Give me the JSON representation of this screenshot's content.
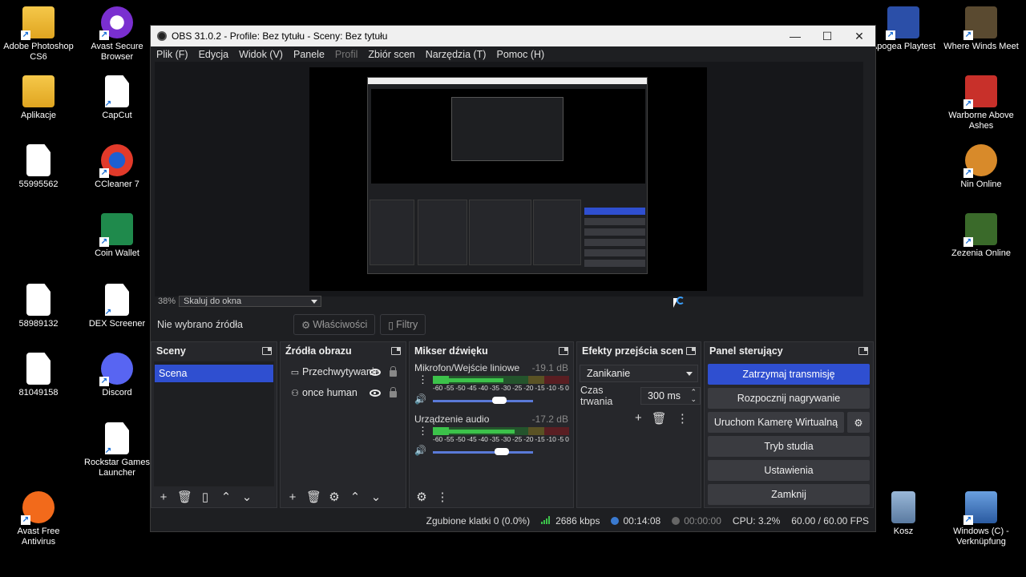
{
  "desktop": {
    "left_icons": [
      {
        "label": "Adobe Photoshop CS6",
        "kind": "folder"
      },
      {
        "label": "Avast Secure Browser",
        "kind": "app"
      },
      {
        "label": "Aplikacje",
        "kind": "folder"
      },
      {
        "label": "CapCut",
        "kind": "doc"
      },
      {
        "label": "55995562",
        "kind": "doc"
      },
      {
        "label": "CCleaner 7",
        "kind": "app"
      },
      {
        "label": "Coin Wallet",
        "kind": "app"
      },
      {
        "label": "58989132",
        "kind": "doc"
      },
      {
        "label": "DEX Screener",
        "kind": "doc"
      },
      {
        "label": "81049158",
        "kind": "doc"
      },
      {
        "label": "Discord",
        "kind": "app"
      },
      {
        "label": "Rockstar Games Launcher",
        "kind": "doc"
      },
      {
        "label": "Avast Free Antivirus",
        "kind": "app"
      }
    ],
    "right_icons": [
      {
        "label": "Apogea Playtest"
      },
      {
        "label": "Where Winds Meet"
      },
      {
        "label": "Warborne Above Ashes"
      },
      {
        "label": "Nin Online"
      },
      {
        "label": "Zezenia Online"
      },
      {
        "label": "Kosz"
      },
      {
        "label": "Windows (C) - Verknüpfung"
      }
    ]
  },
  "window": {
    "title": "OBS 31.0.2 - Profile: Bez tytułu - Sceny: Bez tytułu",
    "controls": {
      "minimize": "—",
      "maximize": "☐",
      "close": "✕"
    }
  },
  "menu": [
    {
      "label": "Plik (F)",
      "enabled": true
    },
    {
      "label": "Edycja",
      "enabled": true
    },
    {
      "label": "Widok (V)",
      "enabled": true
    },
    {
      "label": "Panele",
      "enabled": true
    },
    {
      "label": "Profil",
      "enabled": false
    },
    {
      "label": "Zbiór scen",
      "enabled": true
    },
    {
      "label": "Narzędzia (T)",
      "enabled": true
    },
    {
      "label": "Pomoc (H)",
      "enabled": true
    }
  ],
  "preview": {
    "zoom": "38%",
    "scale_mode": "Skaluj do okna"
  },
  "source_bar": {
    "no_source": "Nie wybrano źródła",
    "properties": "Właściwości",
    "filters": "Filtry"
  },
  "scenes": {
    "title": "Sceny",
    "items": [
      "Scena"
    ]
  },
  "sources": {
    "title": "Źródła obrazu",
    "items": [
      {
        "label": "Przechwytywanie",
        "icon": "monitor-icon"
      },
      {
        "label": "once human",
        "icon": "gamepad-icon"
      }
    ]
  },
  "mixer": {
    "title": "Mikser dźwięku",
    "channels": [
      {
        "name": "Mikrofon/Wejście liniowe",
        "db": "-19.1 dB",
        "volume": 0.66
      },
      {
        "name": "Urządzenie audio",
        "db": "-17.2 dB",
        "volume": 0.69
      }
    ],
    "ticks": [
      "-60",
      "-55",
      "-50",
      "-45",
      "-40",
      "-35",
      "-30",
      "-25",
      "-20",
      "-15",
      "-10",
      "-5",
      "0"
    ],
    "colors": {
      "green": "#3cc24a",
      "yellow": "#d9c23a",
      "red": "#c8303a",
      "dim_green": "#24542c",
      "dim_yellow": "#5a5224",
      "dim_red": "#5a1e22"
    }
  },
  "transitions": {
    "title": "Efekty przejścia scen",
    "selected": "Zanikanie",
    "duration_label": "Czas trwania",
    "duration_value": "300 ms"
  },
  "controls": {
    "title": "Panel sterujący",
    "stop_stream": "Zatrzymaj transmisję",
    "start_recording": "Rozpocznij nagrywanie",
    "virtual_camera": "Uruchom Kamerę Wirtualną",
    "studio_mode": "Tryb studia",
    "settings": "Ustawienia",
    "exit": "Zamknij"
  },
  "status": {
    "dropped_frames": "Zgubione klatki 0 (0.0%)",
    "bitrate": "2686 kbps",
    "stream_time": "00:14:08",
    "record_time": "00:00:00",
    "cpu": "CPU: 3.2%",
    "fps": "60.00 / 60.00 FPS"
  },
  "accent": "#2f4fd0"
}
